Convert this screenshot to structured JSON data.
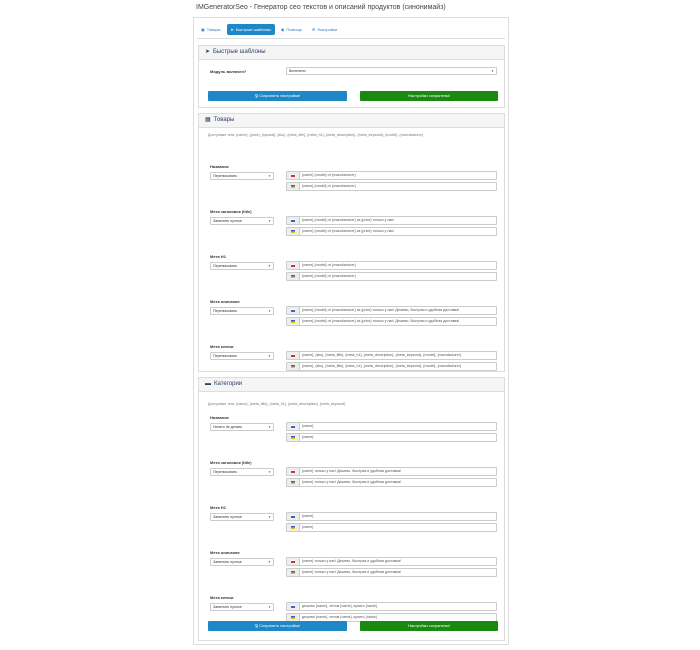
{
  "title": "IMGeneratorSeo - Генератор сео текстов и описаний продуктов (синонимайз)",
  "tabs": [
    {
      "label": "Товары",
      "icon": "box-icon"
    },
    {
      "label": "Быстрые шаблоны",
      "icon": "paper-plane-icon"
    },
    {
      "label": "Помощь",
      "icon": "eye-icon"
    },
    {
      "label": "Настройки",
      "icon": "gear-icon"
    }
  ],
  "quick": {
    "heading": "Быстрые шаблоны",
    "module_label": "Модуль включен?",
    "module_value": "Включено",
    "save_label": "Сохранить настройки!",
    "saved_label": "Настройки сохранены!"
  },
  "products": {
    "heading": "Товары",
    "hint": "Доступные теги: {name}, {price}, {special}, {sku}, {meta_title}, {meta_h1}, {meta_description}, {meta_keyword}, {model}, {manufacturer}",
    "groups": [
      {
        "label": "Название",
        "select": "Переписывать",
        "values": [
          "{name} {model} от {manufacturer}",
          "{name} {model} от {manufacturer}"
        ]
      },
      {
        "label": "Мета заголовок (title)",
        "select": "Заменить пустые",
        "values": [
          "{name} {model} от {manufacturer} за {price} только у нас!",
          "{name} {model} от {manufacturer} за {price} только у нас!"
        ]
      },
      {
        "label": "Мета H1",
        "select": "Переписывать",
        "values": [
          "{name} {model} от {manufacturer}",
          "{name} {model} от {manufacturer}"
        ]
      },
      {
        "label": "Мета описание",
        "select": "Переписывать",
        "values": [
          "{name} {model} от {manufacturer} за {price} только у нас! Дешево, быстрая и удобная доставка!",
          "{name} {model} от {manufacturer} за {price} только у нас! Дешево, быстрая и удобная доставка!"
        ]
      },
      {
        "label": "Мета ключи",
        "select": "Переписывать",
        "values": [
          "{name}, {sku}, {meta_title}, {meta_h1}, {meta_description}, {meta_keyword}, {model}, {manufacturer}",
          "{name}, {sku}, {meta_title}, {meta_h1}, {meta_description}, {meta_keyword}, {model}, {manufacturer}"
        ]
      }
    ]
  },
  "categories": {
    "heading": "Категории",
    "hint": "Доступные теги: {name}, {meta_title}, {meta_h1}, {meta_description}, {meta_keyword}",
    "groups": [
      {
        "label": "Название",
        "select": "Ничего не делать",
        "values": [
          "{name}",
          "{name}"
        ]
      },
      {
        "label": "Мета заголовок (title)",
        "select": "Переписывать",
        "values": [
          "{name} только у нас! Дешево, быстрая и удобная доставка!",
          "{name} только у нас! Дешево, быстрая и удобная доставка!"
        ]
      },
      {
        "label": "Мета H1",
        "select": "Заменить пустые",
        "values": [
          "{name}",
          "{name}"
        ]
      },
      {
        "label": "Мета описание",
        "select": "Заменить пустые",
        "values": [
          "{name} только у нас! Дешево, быстрая и удобная доставка!",
          "{name} только у нас! Дешево, быстрая и удобная доставка!"
        ]
      },
      {
        "label": "Мета ключи",
        "select": "Заменить пустые",
        "values": [
          "дешево {name}, летом {name}, купить {name}",
          "дешево {name}, летом {name}, купить {name}"
        ]
      }
    ],
    "save_label": "Сохранить настройки!",
    "saved_label": "Настройки сохранены!"
  },
  "flags": [
    "ru",
    "uk"
  ]
}
